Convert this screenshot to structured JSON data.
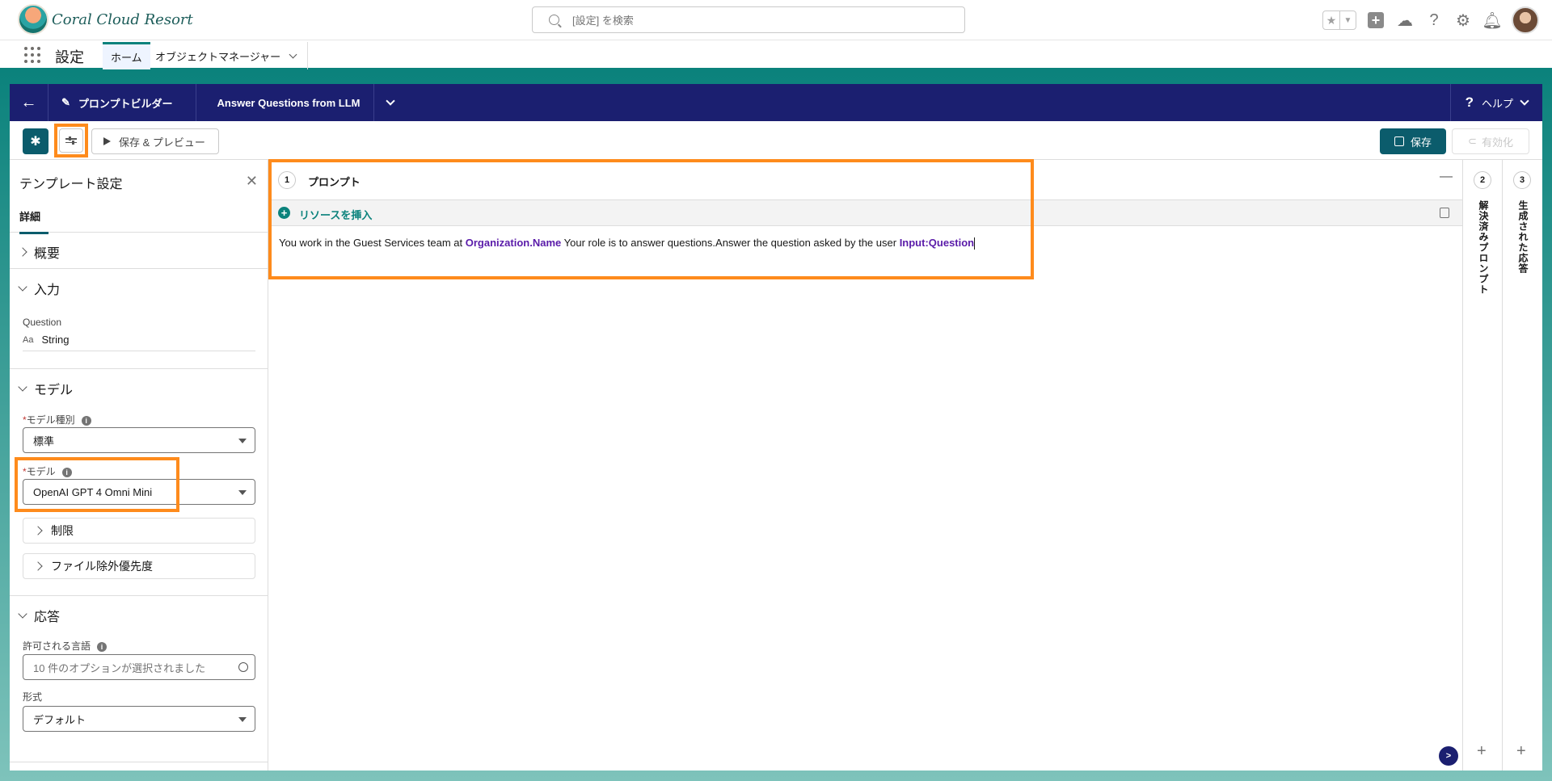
{
  "header": {
    "brand": "Coral Cloud Resort",
    "search_placeholder": "[設定] を検索"
  },
  "context_bar": {
    "app_name": "設定",
    "tabs": [
      {
        "label": "ホーム"
      },
      {
        "label": "オブジェクトマネージャー"
      }
    ]
  },
  "builder": {
    "app_title": "プロンプトビルダー",
    "template_name": "Answer Questions from LLM",
    "help_label": "ヘルプ"
  },
  "toolbar": {
    "preview_label": "保存 & プレビュー",
    "save_label": "保存",
    "activate_label": "有効化"
  },
  "settings_panel": {
    "title": "テンプレート設定",
    "tab": "詳細",
    "overview": {
      "label": "概要"
    },
    "inputs": {
      "label": "入力",
      "field_label": "Question",
      "field_type": "String"
    },
    "model": {
      "label": "モデル",
      "model_type_label": "モデル種別",
      "model_type_value": "標準",
      "model_label": "モデル",
      "model_value": "OpenAI GPT 4 Omni Mini",
      "limits_label": "制限",
      "file_exclusion_label": "ファイル除外優先度"
    },
    "response": {
      "label": "応答",
      "languages_label": "許可される言語",
      "languages_value": "10 件のオプションが選択されました",
      "format_label": "形式",
      "format_value": "デフォルト"
    }
  },
  "prompt": {
    "step_number": "1",
    "title": "プロンプト",
    "insert_resource": "リソースを挿入",
    "text_1": "You work in the Guest Services team at",
    "token_1": "Organization.Name",
    "text_2": "Your role is to answer questions.Answer the question asked by the user",
    "token_2": "Input:Question"
  },
  "rails": [
    {
      "step": "2",
      "label": "解決済みプロンプト"
    },
    {
      "step": "3",
      "label": "生成された応答"
    }
  ]
}
